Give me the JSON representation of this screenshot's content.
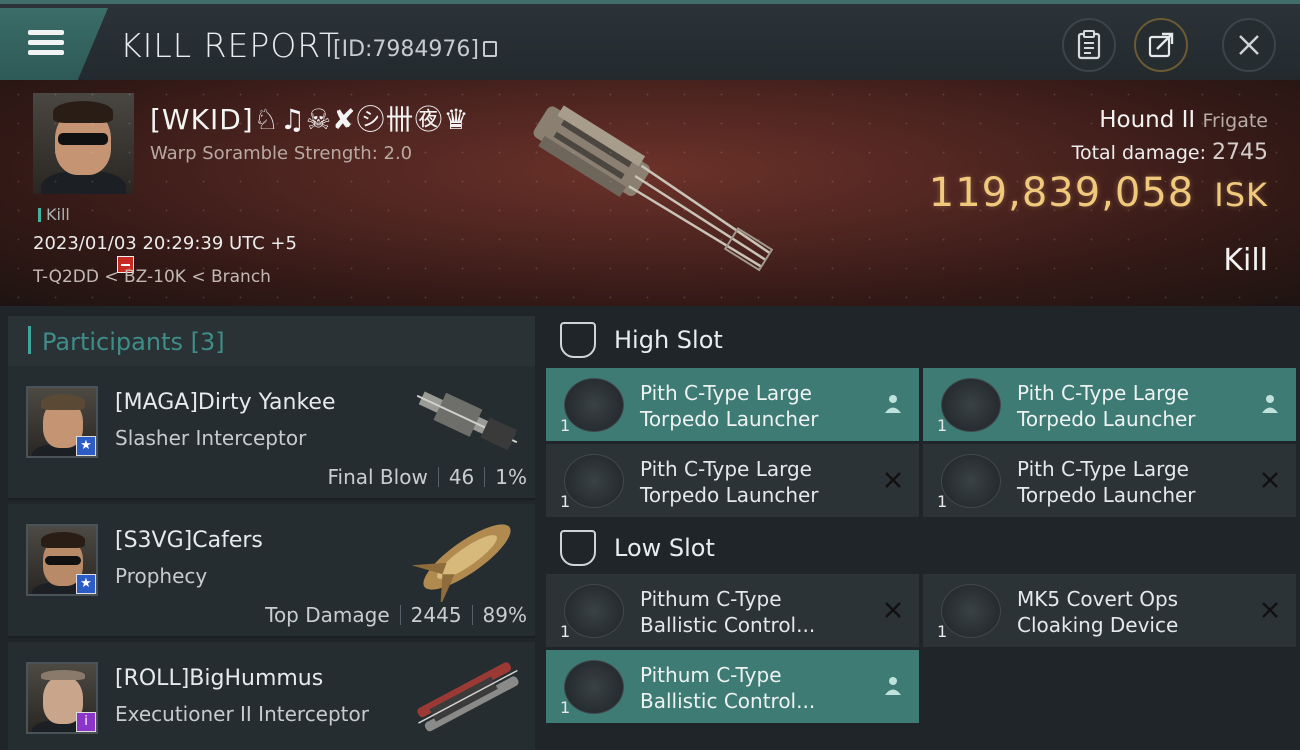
{
  "header": {
    "title": "KILL REPORT",
    "report_id": "[ID:7984976]"
  },
  "victim": {
    "name": "[WKID]♘♫☠✘㋛卌㊰♛",
    "subtitle": "Warp Soramble Strength: 2.0",
    "tag": "Kill",
    "time": "2023/01/03 20:29:39 UTC +5",
    "location": "T-Q2DD < BZ-10K < Branch",
    "ship_name": "Hound II",
    "ship_class": "Frigate",
    "damage_label": "Total damage:",
    "damage_value": "2745",
    "isk_value": "119,839,058",
    "isk_unit": "ISK",
    "status": "Kill"
  },
  "participants": {
    "title": "Participants [3]",
    "rows": [
      {
        "name": "[MAGA]Dirty Yankee",
        "ship": "Slasher Interceptor",
        "role": "Final Blow",
        "damage": "46",
        "percent": "1%"
      },
      {
        "name": "[S3VG]Cafers",
        "ship": "Prophecy",
        "role": "Top Damage",
        "damage": "2445",
        "percent": "89%"
      },
      {
        "name": "[ROLL]BigHummus",
        "ship": "Executioner II Interceptor",
        "role": "",
        "damage": "",
        "percent": ""
      }
    ]
  },
  "fittings": {
    "high_slot_label": "High Slot",
    "low_slot_label": "Low Slot",
    "high": [
      {
        "name1": "Pith C-Type Large",
        "name2": "Torpedo Launcher",
        "qty": "1",
        "state": "dropped"
      },
      {
        "name1": "Pith C-Type Large",
        "name2": "Torpedo Launcher",
        "qty": "1",
        "state": "dropped"
      },
      {
        "name1": "Pith C-Type Large",
        "name2": "Torpedo Launcher",
        "qty": "1",
        "state": "destroyed"
      },
      {
        "name1": "Pith C-Type Large",
        "name2": "Torpedo Launcher",
        "qty": "1",
        "state": "destroyed"
      }
    ],
    "low": [
      {
        "name1": "Pithum C-Type",
        "name2": "Ballistic Control...",
        "qty": "1",
        "state": "destroyed"
      },
      {
        "name1": "MK5 Covert Ops",
        "name2": "Cloaking Device",
        "qty": "1",
        "state": "destroyed"
      },
      {
        "name1": "Pithum C-Type",
        "name2": "Ballistic Control...",
        "qty": "1",
        "state": "dropped"
      }
    ]
  },
  "colors": {
    "accent": "#3d7b74",
    "isk": "#f1c97d",
    "loss_badge": "#c72a23"
  }
}
